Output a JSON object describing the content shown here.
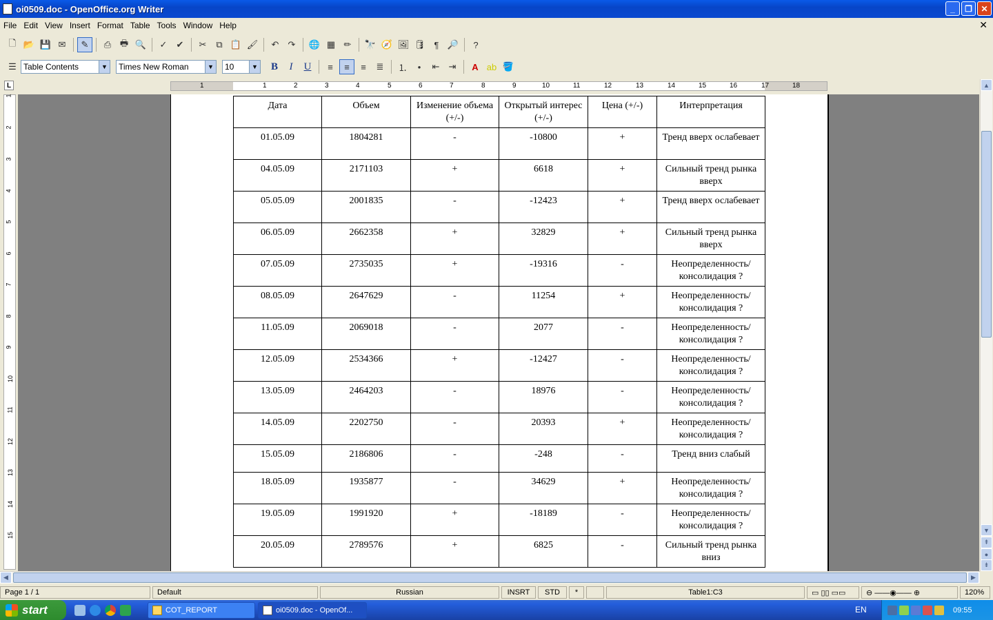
{
  "window": {
    "title": "oi0509.doc - OpenOffice.org Writer"
  },
  "menu": [
    "File",
    "Edit",
    "View",
    "Insert",
    "Format",
    "Table",
    "Tools",
    "Window",
    "Help"
  ],
  "formatting": {
    "style": "Table Contents",
    "font": "Times New Roman",
    "size": "10"
  },
  "ruler": {
    "h_ticks": [
      "1",
      "1",
      "2",
      "3",
      "4",
      "5",
      "6",
      "7",
      "8",
      "9",
      "10",
      "11",
      "12",
      "13",
      "14",
      "15",
      "16",
      "17",
      "18"
    ],
    "v_ticks": [
      "1",
      "2",
      "3",
      "4",
      "5",
      "6",
      "7",
      "8",
      "9",
      "10",
      "11",
      "12",
      "13",
      "14",
      "15"
    ]
  },
  "table": {
    "headers": [
      "Дата",
      "Объем",
      "Изменение объема (+/-)",
      "Открытый интерес (+/-)",
      "Цена (+/-)",
      "Интерпретация"
    ],
    "rows": [
      [
        "01.05.09",
        "1804281",
        "-",
        "-10800",
        "+",
        "Тренд вверх ослабевает"
      ],
      [
        "04.05.09",
        "2171103",
        "+",
        "6618",
        "+",
        "Сильный тренд рынка вверх"
      ],
      [
        "05.05.09",
        "2001835",
        "-",
        "-12423",
        "+",
        "Тренд вверх ослабевает"
      ],
      [
        "06.05.09",
        "2662358",
        "+",
        "32829",
        "+",
        "Сильный тренд рынка вверх"
      ],
      [
        "07.05.09",
        "2735035",
        "+",
        "-19316",
        "-",
        "Неопределенность/ консолидация ?"
      ],
      [
        "08.05.09",
        "2647629",
        "-",
        "11254",
        "+",
        "Неопределенность/ консолидация ?"
      ],
      [
        "11.05.09",
        "2069018",
        "-",
        "2077",
        "-",
        "Неопределенность/ консолидация ?"
      ],
      [
        "12.05.09",
        "2534366",
        "+",
        "-12427",
        "-",
        "Неопределенность/ консолидация ?"
      ],
      [
        "13.05.09",
        "2464203",
        "-",
        "18976",
        "-",
        "Неопределенность/ консолидация ?"
      ],
      [
        "14.05.09",
        "2202750",
        "-",
        "20393",
        "+",
        "Неопределенность/ консолидация ?"
      ],
      [
        "15.05.09",
        "2186806",
        "-",
        "-248",
        "-",
        "Тренд вниз слабый"
      ],
      [
        "18.05.09",
        "1935877",
        "-",
        "34629",
        "+",
        "Неопределенность/ консолидация ?"
      ],
      [
        "19.05.09",
        "1991920",
        "+",
        "-18189",
        "-",
        "Неопределенность/ консолидация ?"
      ],
      [
        "20.05.09",
        "2789576",
        "+",
        "6825",
        "-",
        "Сильный тренд рынка вниз"
      ]
    ]
  },
  "status": {
    "page": "Page 1 / 1",
    "style": "Default",
    "language": "Russian",
    "insert_mode": "INSRT",
    "selection_mode": "STD",
    "modified": "*",
    "cell": "Table1:C3",
    "zoom": "120%"
  },
  "taskbar": {
    "start": "start",
    "tasks": [
      "COT_REPORT",
      "oi0509.doc - OpenOf..."
    ],
    "language": "EN",
    "clock": "09:55"
  }
}
